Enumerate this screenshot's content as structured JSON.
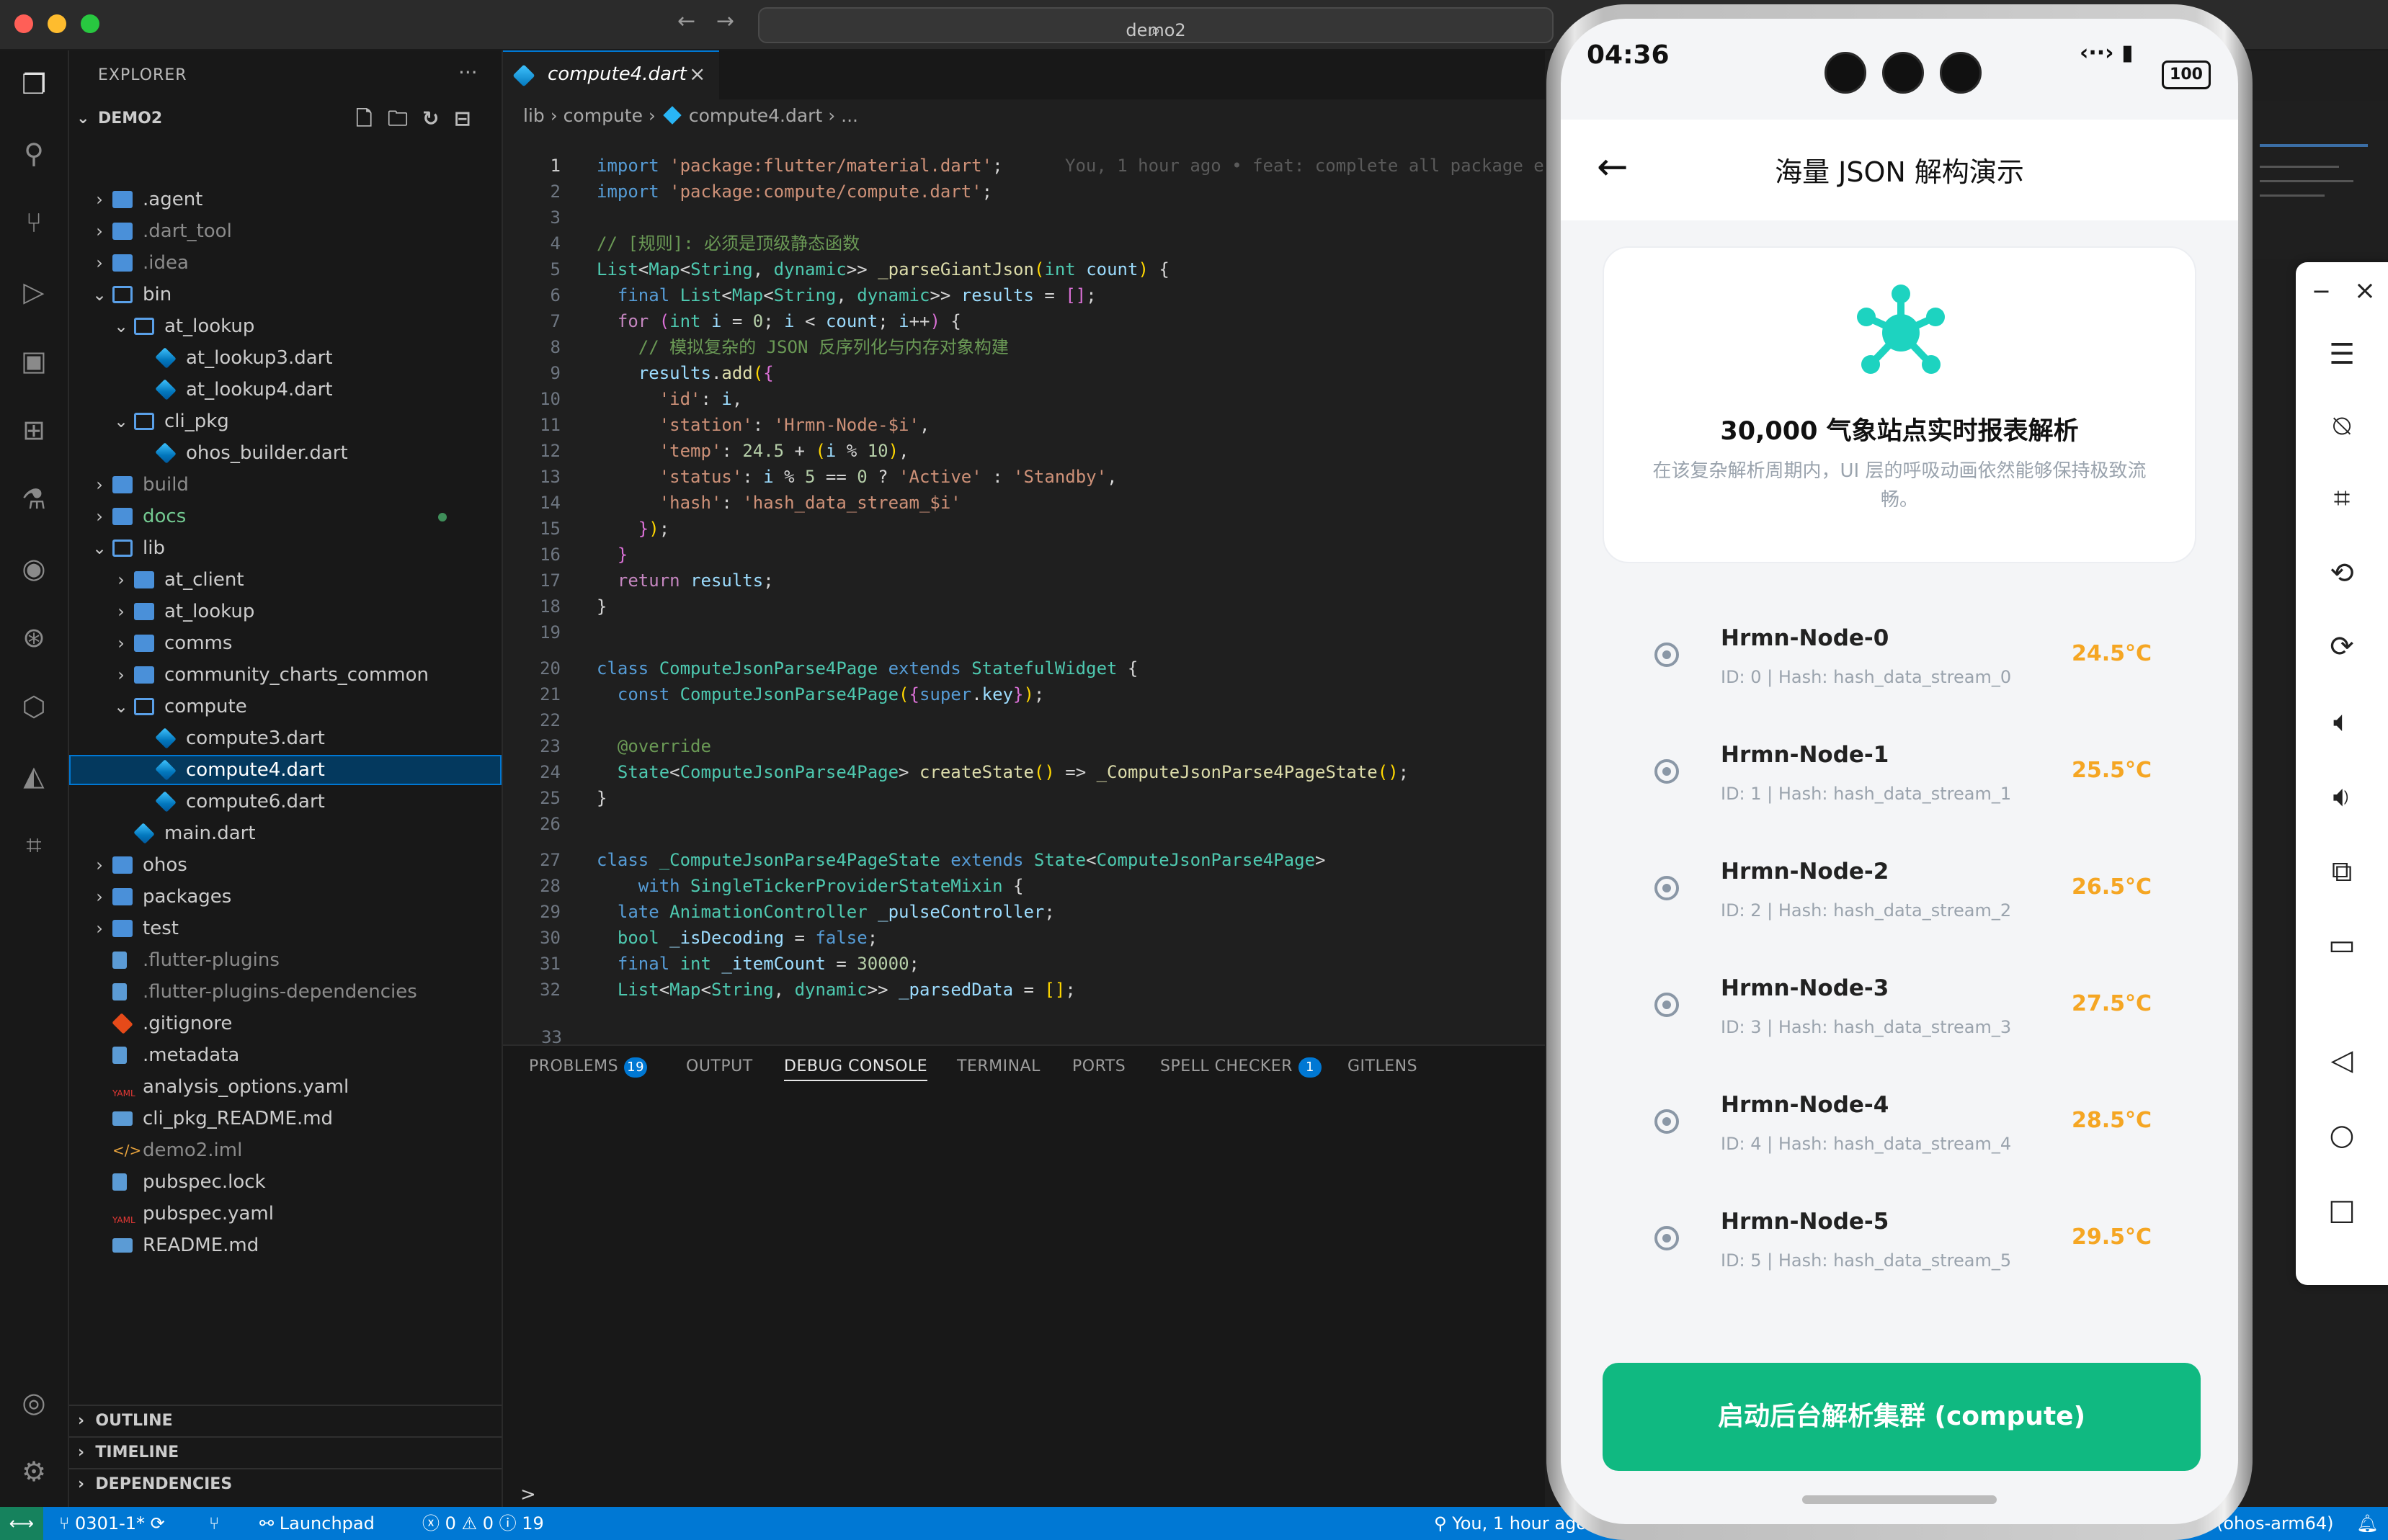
{
  "window": {
    "search_text": "demo2"
  },
  "explorer": {
    "title": "EXPLORER",
    "project": "DEMO2",
    "tree": [
      {
        "label": ".agent",
        "depth": 0,
        "kind": "folder",
        "state": "collapsed"
      },
      {
        "label": ".dart_tool",
        "depth": 0,
        "kind": "folder",
        "state": "collapsed",
        "dim": true
      },
      {
        "label": ".idea",
        "depth": 0,
        "kind": "folder",
        "state": "collapsed",
        "dim": true
      },
      {
        "label": "bin",
        "depth": 0,
        "kind": "folder",
        "state": "open"
      },
      {
        "label": "at_lookup",
        "depth": 1,
        "kind": "folder",
        "state": "open"
      },
      {
        "label": "at_lookup3.dart",
        "depth": 2,
        "kind": "dart"
      },
      {
        "label": "at_lookup4.dart",
        "depth": 2,
        "kind": "dart"
      },
      {
        "label": "cli_pkg",
        "depth": 1,
        "kind": "folder",
        "state": "open"
      },
      {
        "label": "ohos_builder.dart",
        "depth": 2,
        "kind": "dart"
      },
      {
        "label": "build",
        "depth": 0,
        "kind": "folder",
        "state": "collapsed",
        "dim": true
      },
      {
        "label": "docs",
        "depth": 0,
        "kind": "folder",
        "state": "collapsed",
        "green": true
      },
      {
        "label": "lib",
        "depth": 0,
        "kind": "folder",
        "state": "open"
      },
      {
        "label": "at_client",
        "depth": 1,
        "kind": "folder",
        "state": "collapsed"
      },
      {
        "label": "at_lookup",
        "depth": 1,
        "kind": "folder",
        "state": "collapsed"
      },
      {
        "label": "comms",
        "depth": 1,
        "kind": "folder",
        "state": "collapsed"
      },
      {
        "label": "community_charts_common",
        "depth": 1,
        "kind": "folder",
        "state": "collapsed"
      },
      {
        "label": "compute",
        "depth": 1,
        "kind": "folder",
        "state": "open"
      },
      {
        "label": "compute3.dart",
        "depth": 2,
        "kind": "dart"
      },
      {
        "label": "compute4.dart",
        "depth": 2,
        "kind": "dart",
        "selected": true
      },
      {
        "label": "compute6.dart",
        "depth": 2,
        "kind": "dart"
      },
      {
        "label": "main.dart",
        "depth": 1,
        "kind": "dart"
      },
      {
        "label": "ohos",
        "depth": 0,
        "kind": "folder",
        "state": "collapsed"
      },
      {
        "label": "packages",
        "depth": 0,
        "kind": "folder",
        "state": "collapsed"
      },
      {
        "label": "test",
        "depth": 0,
        "kind": "folder",
        "state": "collapsed"
      },
      {
        "label": ".flutter-plugins",
        "depth": 0,
        "kind": "file",
        "dim": true
      },
      {
        "label": ".flutter-plugins-dependencies",
        "depth": 0,
        "kind": "file",
        "dim": true
      },
      {
        "label": ".gitignore",
        "depth": 0,
        "kind": "git"
      },
      {
        "label": ".metadata",
        "depth": 0,
        "kind": "file"
      },
      {
        "label": "analysis_options.yaml",
        "depth": 0,
        "kind": "yaml"
      },
      {
        "label": "cli_pkg_README.md",
        "depth": 0,
        "kind": "md"
      },
      {
        "label": "demo2.iml",
        "depth": 0,
        "kind": "xml",
        "dim": true
      },
      {
        "label": "pubspec.lock",
        "depth": 0,
        "kind": "file"
      },
      {
        "label": "pubspec.yaml",
        "depth": 0,
        "kind": "yaml"
      },
      {
        "label": "README.md",
        "depth": 0,
        "kind": "md"
      }
    ],
    "sections": [
      "OUTLINE",
      "TIMELINE",
      "DEPENDENCIES"
    ]
  },
  "editor": {
    "tab_label": "compute4.dart",
    "breadcrumb": [
      "lib",
      "compute",
      "compute4.dart",
      "..."
    ],
    "blame": "You, 1 hour ago • feat: complete all package e",
    "code": [
      [
        [
          "kw",
          "import "
        ],
        [
          "str",
          "'package:flutter/material.dart'"
        ],
        [
          "pl",
          ";"
        ]
      ],
      [
        [
          "kw",
          "import "
        ],
        [
          "str",
          "'package:compute/compute.dart'"
        ],
        [
          "pl",
          ";"
        ]
      ],
      [],
      [
        [
          "cmt",
          "// [规则]: 必须是顶级静态函数"
        ]
      ],
      [
        [
          "typ",
          "List"
        ],
        [
          "pl",
          "<"
        ],
        [
          "typ",
          "Map"
        ],
        [
          "pl",
          "<"
        ],
        [
          "typ",
          "String"
        ],
        [
          "pl",
          ", "
        ],
        [
          "typ",
          "dynamic"
        ],
        [
          "pl",
          ">> "
        ],
        [
          "fn",
          "_parseGiantJson"
        ],
        [
          "br",
          "("
        ],
        [
          "typ",
          "int"
        ],
        [
          "var",
          " count"
        ],
        [
          "br",
          ")"
        ],
        [
          "pl",
          " {"
        ]
      ],
      [
        [
          "pl",
          "  "
        ],
        [
          "kw",
          "final "
        ],
        [
          "typ",
          "List"
        ],
        [
          "pl",
          "<"
        ],
        [
          "typ",
          "Map"
        ],
        [
          "pl",
          "<"
        ],
        [
          "typ",
          "String"
        ],
        [
          "pl",
          ", "
        ],
        [
          "typ",
          "dynamic"
        ],
        [
          "pl",
          ">> "
        ],
        [
          "var",
          "results"
        ],
        [
          "pl",
          " = "
        ],
        [
          "br2",
          "[]"
        ],
        [
          "pl",
          ";"
        ]
      ],
      [
        [
          "pl",
          "  "
        ],
        [
          "kw2",
          "for "
        ],
        [
          "br2",
          "("
        ],
        [
          "typ",
          "int"
        ],
        [
          "var",
          " i"
        ],
        [
          "pl",
          " = "
        ],
        [
          "num",
          "0"
        ],
        [
          "pl",
          "; "
        ],
        [
          "var",
          "i"
        ],
        [
          "pl",
          " < "
        ],
        [
          "var",
          "count"
        ],
        [
          "pl",
          "; "
        ],
        [
          "var",
          "i"
        ],
        [
          "pl",
          "++"
        ],
        [
          "br2",
          ")"
        ],
        [
          "pl",
          " {"
        ]
      ],
      [
        [
          "pl",
          "    "
        ],
        [
          "cmt",
          "// 模拟复杂的 JSON 反序列化与内存对象构建"
        ]
      ],
      [
        [
          "pl",
          "    "
        ],
        [
          "var",
          "results"
        ],
        [
          "pl",
          "."
        ],
        [
          "fn",
          "add"
        ],
        [
          "br",
          "("
        ],
        [
          "br2",
          "{"
        ]
      ],
      [
        [
          "pl",
          "      "
        ],
        [
          "str",
          "'id'"
        ],
        [
          "pl",
          ": "
        ],
        [
          "var",
          "i"
        ],
        [
          "pl",
          ","
        ]
      ],
      [
        [
          "pl",
          "      "
        ],
        [
          "str",
          "'station'"
        ],
        [
          "pl",
          ": "
        ],
        [
          "str",
          "'Hrmn-Node-$i'"
        ],
        [
          "pl",
          ","
        ]
      ],
      [
        [
          "pl",
          "      "
        ],
        [
          "str",
          "'temp'"
        ],
        [
          "pl",
          ": "
        ],
        [
          "num",
          "24.5"
        ],
        [
          "pl",
          " + "
        ],
        [
          "br",
          "("
        ],
        [
          "var",
          "i"
        ],
        [
          "pl",
          " % "
        ],
        [
          "num",
          "10"
        ],
        [
          "br",
          ")"
        ],
        [
          "pl",
          ","
        ]
      ],
      [
        [
          "pl",
          "      "
        ],
        [
          "str",
          "'status'"
        ],
        [
          "pl",
          ": "
        ],
        [
          "var",
          "i"
        ],
        [
          "pl",
          " % "
        ],
        [
          "num",
          "5"
        ],
        [
          "pl",
          " == "
        ],
        [
          "num",
          "0"
        ],
        [
          "pl",
          " ? "
        ],
        [
          "str",
          "'Active'"
        ],
        [
          "pl",
          " : "
        ],
        [
          "str",
          "'Standby'"
        ],
        [
          "pl",
          ","
        ]
      ],
      [
        [
          "pl",
          "      "
        ],
        [
          "str",
          "'hash'"
        ],
        [
          "pl",
          ": "
        ],
        [
          "str",
          "'hash_data_stream_$i'"
        ]
      ],
      [
        [
          "pl",
          "    "
        ],
        [
          "br2",
          "}"
        ],
        [
          "br",
          ")"
        ],
        [
          "pl",
          ";"
        ]
      ],
      [
        [
          "pl",
          "  "
        ],
        [
          "br2",
          "}"
        ]
      ],
      [
        [
          "pl",
          "  "
        ],
        [
          "kw2",
          "return "
        ],
        [
          "var",
          "results"
        ],
        [
          "pl",
          ";"
        ]
      ],
      [
        [
          "pl",
          "}"
        ]
      ],
      [],
      [
        [
          "kw",
          "class "
        ],
        [
          "typ",
          "ComputeJsonParse4Page "
        ],
        [
          "kw",
          "extends "
        ],
        [
          "typ",
          "StatefulWidget"
        ],
        [
          "pl",
          " {"
        ]
      ],
      [
        [
          "pl",
          "  "
        ],
        [
          "kw",
          "const "
        ],
        [
          "typ",
          "ComputeJsonParse4Page"
        ],
        [
          "br",
          "("
        ],
        [
          "br2",
          "{"
        ],
        [
          "kw",
          "super"
        ],
        [
          "pl",
          "."
        ],
        [
          "var",
          "key"
        ],
        [
          "br2",
          "}"
        ],
        [
          "br",
          ")"
        ],
        [
          "pl",
          ";"
        ]
      ],
      [],
      [
        [
          "pl",
          "  "
        ],
        [
          "cmt",
          "@override"
        ]
      ],
      [
        [
          "pl",
          "  "
        ],
        [
          "typ",
          "State"
        ],
        [
          "pl",
          "<"
        ],
        [
          "typ",
          "ComputeJsonParse4Page"
        ],
        [
          "pl",
          "> "
        ],
        [
          "fn",
          "createState"
        ],
        [
          "br",
          "()"
        ],
        [
          "pl",
          " => "
        ],
        [
          "fn",
          "_ComputeJsonParse4PageState"
        ],
        [
          "br",
          "()"
        ],
        [
          "pl",
          ";"
        ]
      ],
      [
        [
          "pl",
          "}"
        ]
      ],
      [],
      [
        [
          "kw",
          "class "
        ],
        [
          "typ",
          "_ComputeJsonParse4PageState "
        ],
        [
          "kw",
          "extends "
        ],
        [
          "typ",
          "State"
        ],
        [
          "pl",
          "<"
        ],
        [
          "typ",
          "ComputeJsonParse4Page"
        ],
        [
          "pl",
          ">"
        ]
      ],
      [
        [
          "pl",
          "    "
        ],
        [
          "kw",
          "with "
        ],
        [
          "typ",
          "SingleTickerProviderStateMixin"
        ],
        [
          "pl",
          " {"
        ]
      ],
      [
        [
          "pl",
          "  "
        ],
        [
          "kw",
          "late "
        ],
        [
          "typ",
          "AnimationController"
        ],
        [
          "var",
          " _pulseController"
        ],
        [
          "pl",
          ";"
        ]
      ],
      [
        [
          "pl",
          "  "
        ],
        [
          "typ",
          "bool"
        ],
        [
          "var",
          " _isDecoding"
        ],
        [
          "pl",
          " = "
        ],
        [
          "kw",
          "false"
        ],
        [
          "pl",
          ";"
        ]
      ],
      [
        [
          "pl",
          "  "
        ],
        [
          "kw",
          "final "
        ],
        [
          "typ",
          "int"
        ],
        [
          "var",
          " _itemCount"
        ],
        [
          "pl",
          " = "
        ],
        [
          "num",
          "30000"
        ],
        [
          "pl",
          ";"
        ]
      ],
      [
        [
          "pl",
          "  "
        ],
        [
          "typ",
          "List"
        ],
        [
          "pl",
          "<"
        ],
        [
          "typ",
          "Map"
        ],
        [
          "pl",
          "<"
        ],
        [
          "typ",
          "String"
        ],
        [
          "pl",
          ", "
        ],
        [
          "typ",
          "dynamic"
        ],
        [
          "pl",
          ">> "
        ],
        [
          "var",
          "_parsedData"
        ],
        [
          "pl",
          " = "
        ],
        [
          "br",
          "[]"
        ],
        [
          "pl",
          ";"
        ]
      ]
    ],
    "last_line_partial": "33"
  },
  "panel": {
    "tabs": [
      {
        "label": "PROBLEMS",
        "badge": "19"
      },
      {
        "label": "OUTPUT"
      },
      {
        "label": "DEBUG CONSOLE",
        "active": true
      },
      {
        "label": "TERMINAL"
      },
      {
        "label": "PORTS"
      },
      {
        "label": "SPELL CHECKER",
        "badge": "1"
      },
      {
        "label": "GITLENS"
      }
    ],
    "prompt": ">"
  },
  "statusbar": {
    "branch": "0301-1*",
    "launchpad": "Launchpad",
    "errors": "0",
    "warnings": "0",
    "infos": "19",
    "blame": "You, 1 hour ago",
    "device": "(ohos-arm64)"
  },
  "phone": {
    "time": "04:36",
    "battery": "100",
    "title": "海量 JSON 解构演示",
    "header_title": "30,000 气象站点实时报表解析",
    "header_desc": "在该复杂解析周期内，UI 层的呼吸动画依然能够保持极致流畅。",
    "nodes": [
      {
        "name": "Hrmn-Node-0",
        "sub": "ID: 0 | Hash: hash_data_stream_0",
        "temp": "24.5°C"
      },
      {
        "name": "Hrmn-Node-1",
        "sub": "ID: 1 | Hash: hash_data_stream_1",
        "temp": "25.5°C"
      },
      {
        "name": "Hrmn-Node-2",
        "sub": "ID: 2 | Hash: hash_data_stream_2",
        "temp": "26.5°C"
      },
      {
        "name": "Hrmn-Node-3",
        "sub": "ID: 3 | Hash: hash_data_stream_3",
        "temp": "27.5°C"
      },
      {
        "name": "Hrmn-Node-4",
        "sub": "ID: 4 | Hash: hash_data_stream_4",
        "temp": "28.5°C"
      },
      {
        "name": "Hrmn-Node-5",
        "sub": "ID: 5 | Hash: hash_data_stream_5",
        "temp": "29.5°C"
      }
    ],
    "button_label": "启动后台解析集群 (compute)",
    "accent": "#10b981",
    "temp_color": "#f5a623",
    "icon_color": "#1dd3c0"
  },
  "colors": {
    "vscode_blue": "#0078d4",
    "sidebar_bg": "#181818",
    "editor_bg": "#1f1f1f"
  }
}
